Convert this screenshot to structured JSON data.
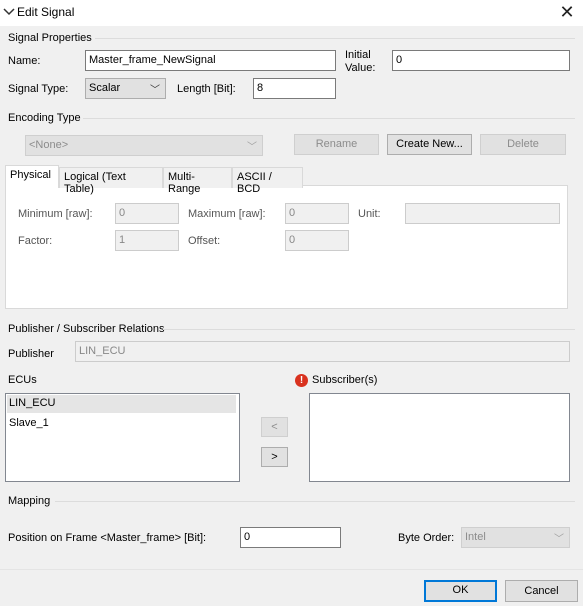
{
  "window": {
    "title": "Edit Signal",
    "close_glyph": "✕"
  },
  "signal_properties": {
    "group_title": "Signal Properties",
    "name_label": "Name:",
    "name_value": "Master_frame_NewSignal",
    "initial_value_label_line1": "Initial",
    "initial_value_label_line2": "Value:",
    "initial_value": "0",
    "signal_type_label": "Signal Type:",
    "signal_type_value": "Scalar",
    "length_label": "Length [Bit]:",
    "length_value": "8"
  },
  "encoding": {
    "group_title": "Encoding Type",
    "selected": "<None>",
    "rename_label": "Rename",
    "create_new_label": "Create New...",
    "delete_label": "Delete"
  },
  "tabs": [
    {
      "label": "Physical"
    },
    {
      "label": "Logical (Text Table)"
    },
    {
      "label": "Multi-Range"
    },
    {
      "label": "ASCII / BCD"
    }
  ],
  "physical": {
    "minimum_label": "Minimum [raw]:",
    "minimum_value": "0",
    "maximum_label": "Maximum [raw]:",
    "maximum_value": "0",
    "unit_label": "Unit:",
    "unit_value": "",
    "factor_label": "Factor:",
    "factor_value": "1",
    "offset_label": "Offset:",
    "offset_value": "0"
  },
  "pubsub": {
    "group_title": "Publisher / Subscriber Relations",
    "publisher_label": "Publisher",
    "publisher_value": "LIN_ECU",
    "ecus_label": "ECUs",
    "ecus": [
      "LIN_ECU",
      "Slave_1"
    ],
    "subscribers_label": "Subscriber(s)",
    "remove_label": "<",
    "add_label": ">",
    "warning_glyph": "!"
  },
  "mapping": {
    "group_title": "Mapping",
    "position_label": "Position on Frame <Master_frame> [Bit]:",
    "position_value": "0",
    "byte_order_label": "Byte Order:",
    "byte_order_value": "Intel"
  },
  "footer": {
    "ok_label": "OK",
    "cancel_label": "Cancel"
  },
  "icons": {
    "dropdown": "﹀"
  }
}
